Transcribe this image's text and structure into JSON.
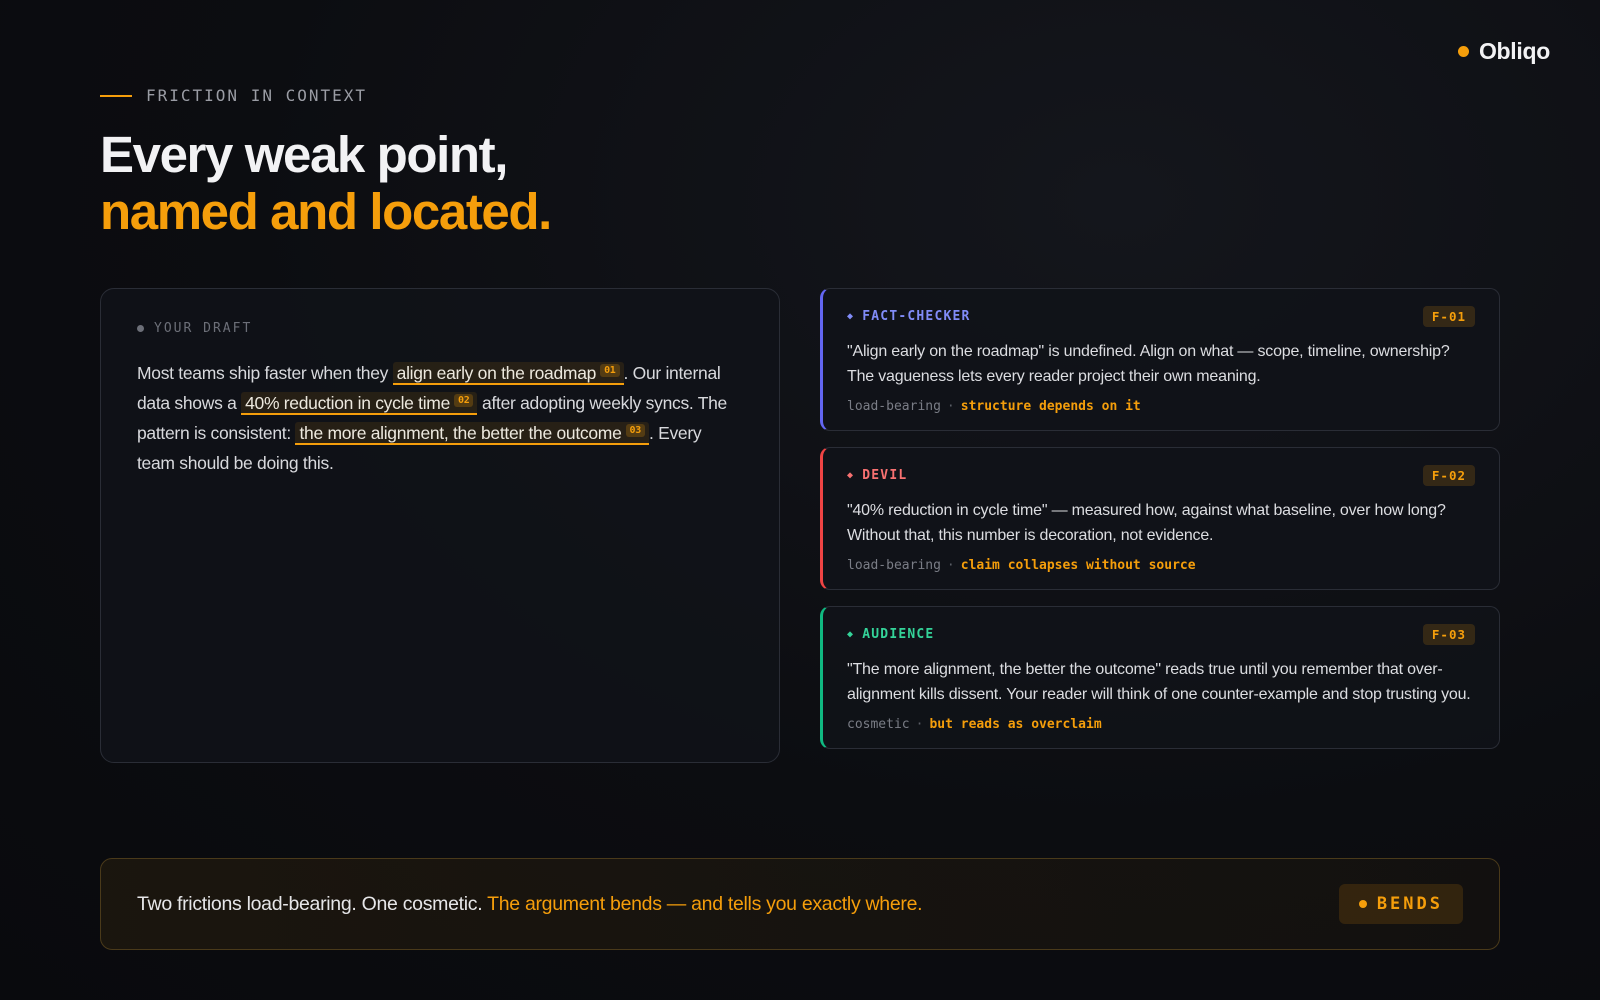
{
  "brand": {
    "name": "Obliqo",
    "accent_color": "#f59e0b"
  },
  "eyebrow": "FRICTION IN CONTEXT",
  "headline": {
    "line1": "Every weak point,",
    "line2": "named and located."
  },
  "draft": {
    "label": "YOUR DRAFT",
    "segments": {
      "t1": "Most teams ship faster when they ",
      "h1": "align early on the roadmap",
      "n1": "01",
      "t2": ". Our internal data shows a ",
      "h2": "40% reduction in cycle time",
      "n2": "02",
      "t3": " after adopting weekly syncs. The pattern is consistent: ",
      "h3": "the more alignment, the better the outcome",
      "n3": "03",
      "t4": ". Every team should be doing this."
    }
  },
  "frictions": [
    {
      "role": "FACT-CHECKER",
      "role_color": "#6366f1",
      "id": "F-01",
      "body": "\"Align early on the roadmap\" is undefined. Align on what — scope, timeline, ownership? The vagueness lets every reader project their own meaning.",
      "severity": "load-bearing",
      "separator": "·",
      "note": "structure depends on it"
    },
    {
      "role": "DEVIL",
      "role_color": "#ef4444",
      "id": "F-02",
      "body": "\"40% reduction in cycle time\" — measured how, against what baseline, over how long? Without that, this number is decoration, not evidence.",
      "severity": "load-bearing",
      "separator": "·",
      "note": "claim collapses without source"
    },
    {
      "role": "AUDIENCE",
      "role_color": "#10b981",
      "id": "F-03",
      "body": "\"The more alignment, the better the outcome\" reads true until you remember that over-alignment kills dissent. Your reader will think of one counter-example and stop trusting you.",
      "severity": "cosmetic",
      "separator": "·",
      "note": "but reads as overclaim"
    }
  ],
  "verdict": {
    "text": "Two frictions load-bearing. One cosmetic. ",
    "accent": "The argument bends — and tells you exactly where.",
    "badge": "BENDS"
  }
}
